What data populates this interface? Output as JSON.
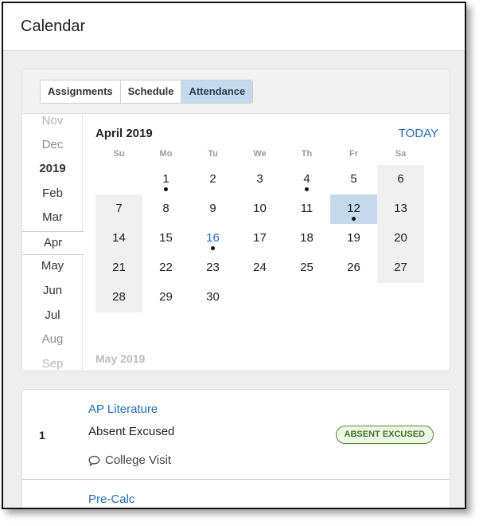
{
  "header": {
    "title": "Calendar"
  },
  "tabs": [
    {
      "label": "Assignments",
      "active": false
    },
    {
      "label": "Schedule",
      "active": false
    },
    {
      "label": "Attendance",
      "active": true
    }
  ],
  "month_list": [
    "Nov",
    "Dec",
    "2019",
    "Feb",
    "Mar",
    "Apr",
    "May",
    "Jun",
    "Jul",
    "Aug",
    "Sep"
  ],
  "selected_month": "Apr",
  "calendar": {
    "month_label": "April 2019",
    "today_label": "TODAY",
    "weekdays": [
      "Su",
      "Mo",
      "Tu",
      "We",
      "Th",
      "Fr",
      "Sa"
    ],
    "weeks": [
      [
        "",
        "1",
        "2",
        "3",
        "4",
        "5",
        "6"
      ],
      [
        "7",
        "8",
        "9",
        "10",
        "11",
        "12",
        "13"
      ],
      [
        "14",
        "15",
        "16",
        "17",
        "18",
        "19",
        "20"
      ],
      [
        "21",
        "22",
        "23",
        "24",
        "25",
        "26",
        "27"
      ],
      [
        "28",
        "29",
        "30",
        "",
        "",
        "",
        ""
      ]
    ],
    "days_with_events": [
      "1",
      "4",
      "12",
      "16"
    ],
    "selected_day": "12",
    "today": "16",
    "next_month_label": "May 2019"
  },
  "entries": [
    {
      "period": "1",
      "course": "AP Literature",
      "status": "Absent Excused",
      "comment": "College Visit",
      "badge": "ABSENT EXCUSED",
      "badge_color": "#3f7a22"
    },
    {
      "period": "",
      "course": "Pre-Calc"
    }
  ],
  "colors": {
    "accent": "#1f6db4",
    "selected": "#c5d9ee",
    "weekend": "#efefef"
  }
}
